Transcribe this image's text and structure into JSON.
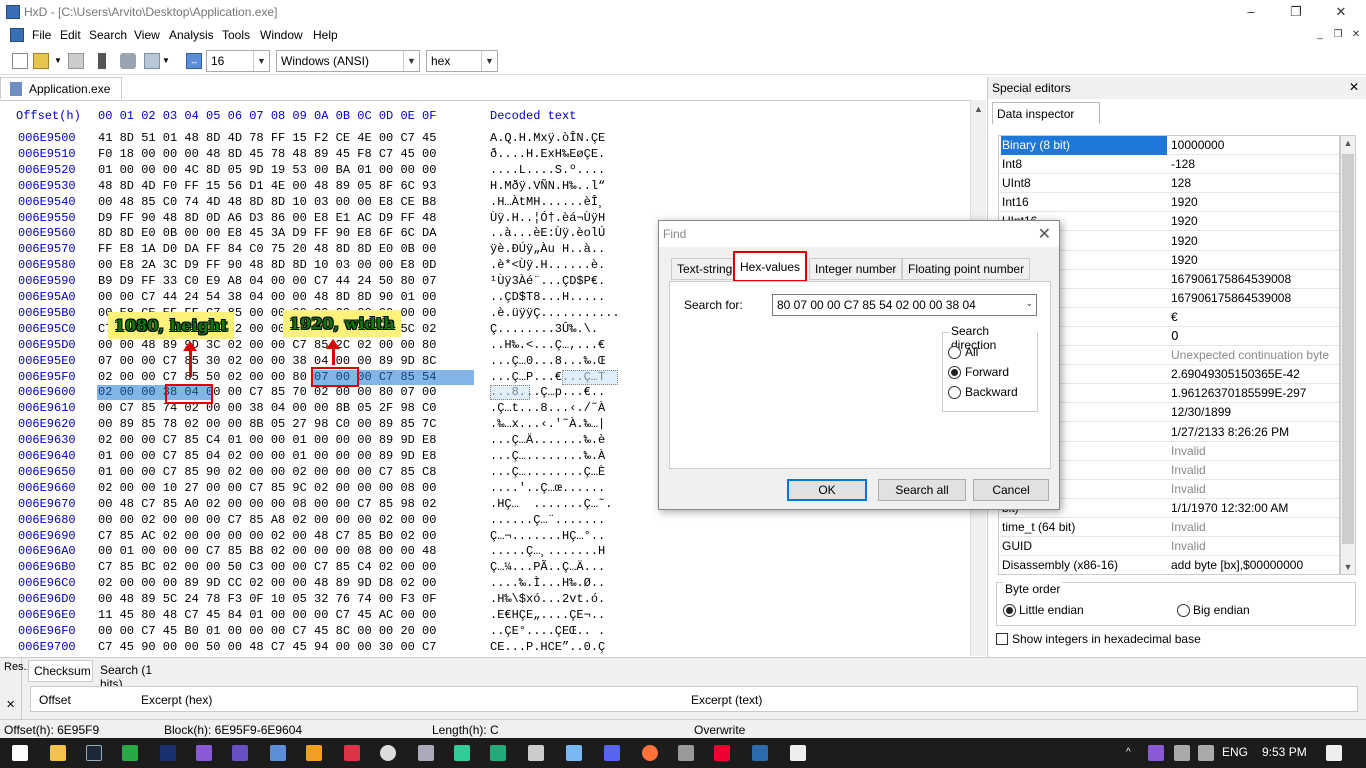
{
  "window": {
    "title": "HxD - [C:\\Users\\Arvito\\Desktop\\Application.exe]",
    "minimize": "–",
    "restore": "❐",
    "close": "✕"
  },
  "menu": {
    "items": [
      "File",
      "Edit",
      "Search",
      "View",
      "Analysis",
      "Tools",
      "Window",
      "Help"
    ],
    "mdi_min": "_",
    "mdi_restore": "❐",
    "mdi_close": "✕"
  },
  "toolbar": {
    "bytes_per_row": "16",
    "charset": "Windows (ANSI)",
    "offset_base": "hex"
  },
  "document_tab": {
    "label": "Application.exe"
  },
  "hex": {
    "header_offset": "Offset(h)",
    "header_columns": "00 01 02 03 04 05 06 07 08 09 0A 0B 0C 0D 0E 0F",
    "header_decoded": "Decoded text",
    "rows": [
      {
        "o": "006E9500",
        "h": "41 8D 51 01 48 8D 4D 78 FF 15 F2 CE 4E 00 C7 45",
        "t": "A.Q.H.Mxÿ.òÎN.ÇE"
      },
      {
        "o": "006E9510",
        "h": "F0 18 00 00 00 48 8D 45 78 48 89 45 F8 C7 45 00",
        "t": "ð....H.ExH‰EøÇE."
      },
      {
        "o": "006E9520",
        "h": "01 00 00 00 4C 8D 05 9D 19 53 00 BA 01 00 00 00",
        "t": "....L....S.º...."
      },
      {
        "o": "006E9530",
        "h": "48 8D 4D F0 FF 15 56 D1 4E 00 48 89 05 8F 6C 93",
        "t": "H.Mðÿ.VÑN.H‰..l“"
      },
      {
        "o": "006E9540",
        "h": "00 48 85 C0 74 4D 48 8D 8D 10 03 00 00 E8 CE B8",
        "t": ".H…ÀtMH......èÎ¸"
      },
      {
        "o": "006E9550",
        "h": "D9 FF 90 48 8D 0D A6 D3 86 00 E8 E1 AC D9 FF 48",
        "t": "Ùÿ.H..¦Ó†.èá¬ÙÿH"
      },
      {
        "o": "006E9560",
        "h": "8D 8D E0 0B 00 00 E8 45 3A D9 FF 90 E8 6F 6C DA",
        "t": "..à...èE:Ùÿ.èolÚ"
      },
      {
        "o": "006E9570",
        "h": "FF E8 1A D0 DA FF 84 C0 75 20 48 8D 8D E0 0B 00",
        "t": "ÿè.ÐÚÿ„Àu H..à.."
      },
      {
        "o": "006E9580",
        "h": "00 E8 2A 3C D9 FF 90 48 8D 8D 10 03 00 00 E8 0D",
        "t": ".è*<Ùÿ.H......è."
      },
      {
        "o": "006E9590",
        "h": "B9 D9 FF 33 C0 E9 A8 04 00 00 C7 44 24 50 80 07",
        "t": "¹Ùÿ3Àé¨...ÇD$P€."
      },
      {
        "o": "006E95A0",
        "h": "00 00 C7 44 24 54 38 04 00 00 48 8D 8D 90 01 00",
        "t": "..ÇD$T8...H....."
      },
      {
        "o": "006E95B0",
        "h": "00 E8 CE EF FF C7 85 00 00 00 00 00 00 00 00 00",
        "t": ".è.üÿÿÇ..........."
      },
      {
        "o": "006E95C0",
        "h": "C7 85 00 00 00 00 02 00 00 00 00 00 00 9D 5C 02",
        "t": "Ç........3Û‰.\\."
      },
      {
        "o": "006E95D0",
        "h": "00 00 48 89 9D 3C 02 00 00 C7 85 2C 02 00 00 80",
        "t": "..H‰.<...Ç…,...€"
      },
      {
        "o": "006E95E0",
        "h": "07 00 00 C7 85 30 02 00 00 38 04 00 00 89 9D 8C",
        "t": "...Ç…0...8...‰.Œ"
      },
      {
        "o": "006E95F0",
        "h": "02 00 00 C7 85 50 02 00 00 80 07 00 00 C7 85 54",
        "t": "...Ç…P...€...Ç…T"
      },
      {
        "o": "006E9600",
        "h": "02 00 00 38 04 00 00 C7 85 70 02 00 00 80 07 00",
        "t": "...8...Ç…p...€.."
      },
      {
        "o": "006E9610",
        "h": "00 C7 85 74 02 00 00 38 04 00 00 8B 05 2F 98 C0",
        "t": ".Ç…t...8...‹./˜À"
      },
      {
        "o": "006E9620",
        "h": "00 89 85 78 02 00 00 8B 05 27 98 C0 00 89 85 7C",
        "t": ".‰…x...‹.'˜À.‰…|"
      },
      {
        "o": "006E9630",
        "h": "02 00 00 C7 85 C4 01 00 00 01 00 00 00 89 9D E8",
        "t": "...Ç…Ä.......‰.è"
      },
      {
        "o": "006E9640",
        "h": "01 00 00 C7 85 04 02 00 00 01 00 00 00 89 9D E8",
        "t": "...Ç…........‰.À"
      },
      {
        "o": "006E9650",
        "h": "01 00 00 C7 85 90 02 00 00 02 00 00 00 C7 85 C8",
        "t": "...Ç…........Ç…È"
      },
      {
        "o": "006E9660",
        "h": "02 00 00 10 27 00 00 C7 85 9C 02 00 00 00 08 00",
        "t": "....'..Ç…œ......"
      },
      {
        "o": "006E9670",
        "h": "00 48 C7 85 A0 02 00 00 00 08 00 00 C7 85 98 02",
        "t": ".HÇ…  .......Ç…˜."
      },
      {
        "o": "006E9680",
        "h": "00 00 02 00 00 00 C7 85 A8 02 00 00 00 02 00 00",
        "t": "......Ç…¨......."
      },
      {
        "o": "006E9690",
        "h": "C7 85 AC 02 00 00 00 00 02 00 48 C7 85 B0 02 00",
        "t": "Ç…¬.......HÇ…°.."
      },
      {
        "o": "006E96A0",
        "h": "00 01 00 00 00 C7 85 B8 02 00 00 00 08 00 00 48",
        "t": ".....Ç…¸.......H"
      },
      {
        "o": "006E96B0",
        "h": "C7 85 BC 02 00 00 50 C3 00 00 C7 85 C4 02 00 00",
        "t": "Ç…¼...PÃ..Ç…Ä..."
      },
      {
        "o": "006E96C0",
        "h": "02 00 00 00 89 9D CC 02 00 00 48 89 9D D8 02 00",
        "t": "....‰.Ì...H‰.Ø.."
      },
      {
        "o": "006E96D0",
        "h": "00 48 89 5C 24 78 F3 0F 10 05 32 76 74 00 F3 0F",
        "t": ".H‰\\$xó...2vt.ó."
      },
      {
        "o": "006E96E0",
        "h": "11 45 80 48 C7 45 84 01 00 00 00 C7 45 AC 00 00",
        "t": ".E€HÇE„....ÇE¬.."
      },
      {
        "o": "006E96F0",
        "h": "00 00 C7 45 B0 01 00 00 00 C7 45 8C 00 00 20 00",
        "t": "..ÇE°....ÇEŒ.. ."
      },
      {
        "o": "006E9700",
        "h": "C7 45 90 00 00 50 00 48 C7 45 94 00 00 30 00 C7",
        "t": "CE...P.HCE”..0.Ç"
      }
    ]
  },
  "annotations": {
    "height": "1080, height",
    "width": "1920, width"
  },
  "special_editors": {
    "title": "Special editors",
    "close": "✕",
    "tab": "Data inspector",
    "rows": [
      {
        "k": "Binary (8 bit)",
        "v": "10000000"
      },
      {
        "k": "Int8",
        "v": "-128"
      },
      {
        "k": "UInt8",
        "v": "128"
      },
      {
        "k": "Int16",
        "v": "1920"
      },
      {
        "k": "UInt16",
        "v": "1920"
      },
      {
        "k": "",
        "v": "1920"
      },
      {
        "k": "",
        "v": "1920"
      },
      {
        "k": "",
        "v": "167906175864539008"
      },
      {
        "k": "",
        "v": "167906175864539008"
      },
      {
        "k": "char8_t",
        "v": "€"
      },
      {
        "k": "char16_t",
        "v": "߀"
      },
      {
        "k": "epoint",
        "v": "Unexpected continuation byte"
      },
      {
        "k": "t32)",
        "v": "2.69049305150365E-42"
      },
      {
        "k": "at64)",
        "v": "1.96126370185599E-297"
      },
      {
        "k": "",
        "v": "12/30/1899"
      },
      {
        "k": "",
        "v": "1/27/2133 8:26:26 PM"
      },
      {
        "k": "",
        "v": "Invalid"
      },
      {
        "k": "",
        "v": "Invalid"
      },
      {
        "k": "t date",
        "v": "Invalid"
      },
      {
        "k": "bit)",
        "v": "1/1/1970 12:32:00 AM"
      },
      {
        "k": "time_t (64 bit)",
        "v": "Invalid"
      },
      {
        "k": "GUID",
        "v": "Invalid"
      },
      {
        "k": "Disassembly (x86-16)",
        "v": "add byte [bx],$00000000"
      }
    ],
    "byte_order_label": "Byte order",
    "little_endian": "Little endian",
    "big_endian": "Big endian",
    "hex_base_label": "Show integers in hexadecimal base"
  },
  "find_dialog": {
    "title": "Find",
    "close": "✕",
    "tabs": [
      "Text-string",
      "Hex-values",
      "Integer number",
      "Floating point number"
    ],
    "search_for_label": "Search for:",
    "search_for_value": "80 07 00 00 C7 85 54 02 00 00 38 04",
    "direction_label": "Search direction",
    "directions": [
      "All",
      "Forward",
      "Backward"
    ],
    "ok": "OK",
    "search_all": "Search all",
    "cancel": "Cancel"
  },
  "results_pane": {
    "side_label": "Res...",
    "tabs": [
      "Checksum",
      "Search (1 hits)"
    ],
    "columns": [
      "Offset",
      "Excerpt (hex)",
      "Excerpt (text)"
    ]
  },
  "status": {
    "offset": "Offset(h): 6E95F9",
    "block": "Block(h): 6E95F9-6E9604",
    "length": "Length(h): C",
    "mode": "Overwrite"
  },
  "taskbar": {
    "language": "ENG",
    "time": "9:53 PM"
  },
  "colors": {
    "selection": "#1e78d7",
    "highlight_box": "#e00000",
    "offset_blue": "#0000c8",
    "annotation_bg": "#fff27a",
    "annotation_text": "#0b7a0b"
  }
}
